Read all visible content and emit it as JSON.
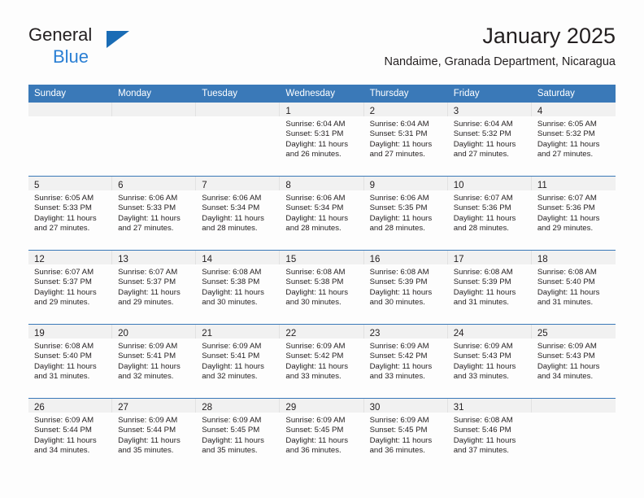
{
  "brand": {
    "name_primary": "General",
    "name_secondary": "Blue",
    "flag_color": "#1a6cb5",
    "secondary_color": "#2a7fd4"
  },
  "header": {
    "title": "January 2025",
    "subtitle": "Nandaime, Granada Department, Nicaragua",
    "accent_color": "#3a79b8"
  },
  "calendar": {
    "weekday_headers": [
      "Sunday",
      "Monday",
      "Tuesday",
      "Wednesday",
      "Thursday",
      "Friday",
      "Saturday"
    ],
    "weeks": [
      [
        {
          "day": "",
          "empty": true
        },
        {
          "day": "",
          "empty": true
        },
        {
          "day": "",
          "empty": true
        },
        {
          "day": "1",
          "sunrise": "Sunrise: 6:04 AM",
          "sunset": "Sunset: 5:31 PM",
          "daylight": "Daylight: 11 hours and 26 minutes."
        },
        {
          "day": "2",
          "sunrise": "Sunrise: 6:04 AM",
          "sunset": "Sunset: 5:31 PM",
          "daylight": "Daylight: 11 hours and 27 minutes."
        },
        {
          "day": "3",
          "sunrise": "Sunrise: 6:04 AM",
          "sunset": "Sunset: 5:32 PM",
          "daylight": "Daylight: 11 hours and 27 minutes."
        },
        {
          "day": "4",
          "sunrise": "Sunrise: 6:05 AM",
          "sunset": "Sunset: 5:32 PM",
          "daylight": "Daylight: 11 hours and 27 minutes."
        }
      ],
      [
        {
          "day": "5",
          "sunrise": "Sunrise: 6:05 AM",
          "sunset": "Sunset: 5:33 PM",
          "daylight": "Daylight: 11 hours and 27 minutes."
        },
        {
          "day": "6",
          "sunrise": "Sunrise: 6:06 AM",
          "sunset": "Sunset: 5:33 PM",
          "daylight": "Daylight: 11 hours and 27 minutes."
        },
        {
          "day": "7",
          "sunrise": "Sunrise: 6:06 AM",
          "sunset": "Sunset: 5:34 PM",
          "daylight": "Daylight: 11 hours and 28 minutes."
        },
        {
          "day": "8",
          "sunrise": "Sunrise: 6:06 AM",
          "sunset": "Sunset: 5:34 PM",
          "daylight": "Daylight: 11 hours and 28 minutes."
        },
        {
          "day": "9",
          "sunrise": "Sunrise: 6:06 AM",
          "sunset": "Sunset: 5:35 PM",
          "daylight": "Daylight: 11 hours and 28 minutes."
        },
        {
          "day": "10",
          "sunrise": "Sunrise: 6:07 AM",
          "sunset": "Sunset: 5:36 PM",
          "daylight": "Daylight: 11 hours and 28 minutes."
        },
        {
          "day": "11",
          "sunrise": "Sunrise: 6:07 AM",
          "sunset": "Sunset: 5:36 PM",
          "daylight": "Daylight: 11 hours and 29 minutes."
        }
      ],
      [
        {
          "day": "12",
          "sunrise": "Sunrise: 6:07 AM",
          "sunset": "Sunset: 5:37 PM",
          "daylight": "Daylight: 11 hours and 29 minutes."
        },
        {
          "day": "13",
          "sunrise": "Sunrise: 6:07 AM",
          "sunset": "Sunset: 5:37 PM",
          "daylight": "Daylight: 11 hours and 29 minutes."
        },
        {
          "day": "14",
          "sunrise": "Sunrise: 6:08 AM",
          "sunset": "Sunset: 5:38 PM",
          "daylight": "Daylight: 11 hours and 30 minutes."
        },
        {
          "day": "15",
          "sunrise": "Sunrise: 6:08 AM",
          "sunset": "Sunset: 5:38 PM",
          "daylight": "Daylight: 11 hours and 30 minutes."
        },
        {
          "day": "16",
          "sunrise": "Sunrise: 6:08 AM",
          "sunset": "Sunset: 5:39 PM",
          "daylight": "Daylight: 11 hours and 30 minutes."
        },
        {
          "day": "17",
          "sunrise": "Sunrise: 6:08 AM",
          "sunset": "Sunset: 5:39 PM",
          "daylight": "Daylight: 11 hours and 31 minutes."
        },
        {
          "day": "18",
          "sunrise": "Sunrise: 6:08 AM",
          "sunset": "Sunset: 5:40 PM",
          "daylight": "Daylight: 11 hours and 31 minutes."
        }
      ],
      [
        {
          "day": "19",
          "sunrise": "Sunrise: 6:08 AM",
          "sunset": "Sunset: 5:40 PM",
          "daylight": "Daylight: 11 hours and 31 minutes."
        },
        {
          "day": "20",
          "sunrise": "Sunrise: 6:09 AM",
          "sunset": "Sunset: 5:41 PM",
          "daylight": "Daylight: 11 hours and 32 minutes."
        },
        {
          "day": "21",
          "sunrise": "Sunrise: 6:09 AM",
          "sunset": "Sunset: 5:41 PM",
          "daylight": "Daylight: 11 hours and 32 minutes."
        },
        {
          "day": "22",
          "sunrise": "Sunrise: 6:09 AM",
          "sunset": "Sunset: 5:42 PM",
          "daylight": "Daylight: 11 hours and 33 minutes."
        },
        {
          "day": "23",
          "sunrise": "Sunrise: 6:09 AM",
          "sunset": "Sunset: 5:42 PM",
          "daylight": "Daylight: 11 hours and 33 minutes."
        },
        {
          "day": "24",
          "sunrise": "Sunrise: 6:09 AM",
          "sunset": "Sunset: 5:43 PM",
          "daylight": "Daylight: 11 hours and 33 minutes."
        },
        {
          "day": "25",
          "sunrise": "Sunrise: 6:09 AM",
          "sunset": "Sunset: 5:43 PM",
          "daylight": "Daylight: 11 hours and 34 minutes."
        }
      ],
      [
        {
          "day": "26",
          "sunrise": "Sunrise: 6:09 AM",
          "sunset": "Sunset: 5:44 PM",
          "daylight": "Daylight: 11 hours and 34 minutes."
        },
        {
          "day": "27",
          "sunrise": "Sunrise: 6:09 AM",
          "sunset": "Sunset: 5:44 PM",
          "daylight": "Daylight: 11 hours and 35 minutes."
        },
        {
          "day": "28",
          "sunrise": "Sunrise: 6:09 AM",
          "sunset": "Sunset: 5:45 PM",
          "daylight": "Daylight: 11 hours and 35 minutes."
        },
        {
          "day": "29",
          "sunrise": "Sunrise: 6:09 AM",
          "sunset": "Sunset: 5:45 PM",
          "daylight": "Daylight: 11 hours and 36 minutes."
        },
        {
          "day": "30",
          "sunrise": "Sunrise: 6:09 AM",
          "sunset": "Sunset: 5:45 PM",
          "daylight": "Daylight: 11 hours and 36 minutes."
        },
        {
          "day": "31",
          "sunrise": "Sunrise: 6:08 AM",
          "sunset": "Sunset: 5:46 PM",
          "daylight": "Daylight: 11 hours and 37 minutes."
        },
        {
          "day": "",
          "empty": true
        }
      ]
    ]
  }
}
